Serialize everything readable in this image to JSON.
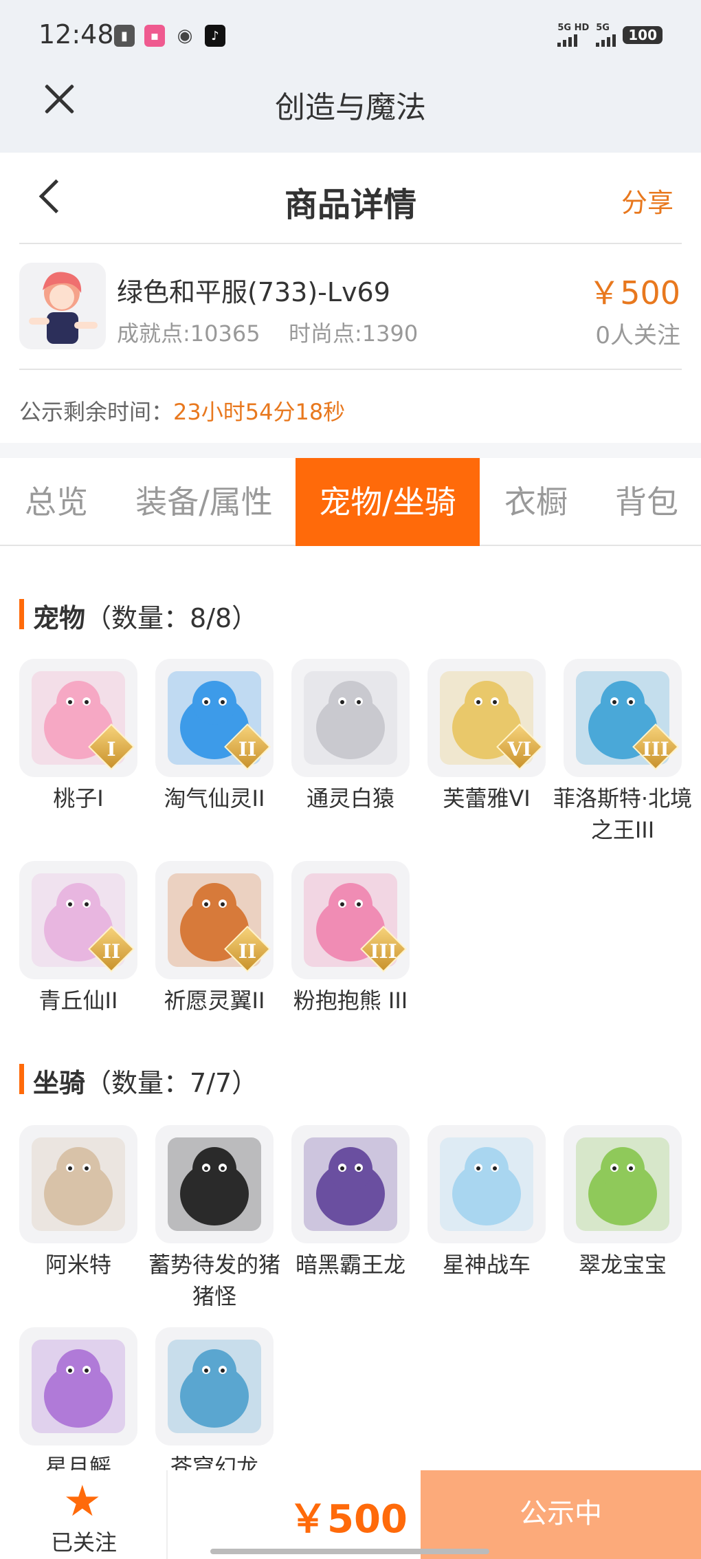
{
  "status_bar": {
    "time": "12:48",
    "network": [
      "5G",
      "HD",
      "5G"
    ],
    "battery": "100"
  },
  "app_bar": {
    "title": "创造与魔法"
  },
  "header": {
    "title": "商品详情",
    "share": "分享"
  },
  "product": {
    "name": "绿色和平服(733)-Lv69",
    "achievement": "成就点:10365",
    "fashion": "时尚点:1390",
    "price": "￥500",
    "followers": "0人关注"
  },
  "notice": {
    "label": "公示剩余时间：",
    "value": "23小时54分18秒"
  },
  "tabs": [
    {
      "label": "总览",
      "active": false
    },
    {
      "label": "装备/属性",
      "active": false
    },
    {
      "label": "宠物/坐骑",
      "active": true
    },
    {
      "label": "衣橱",
      "active": false
    },
    {
      "label": "背包",
      "active": false
    }
  ],
  "pets_section": {
    "title": "宠物",
    "count": "（数量：8/8）",
    "items": [
      {
        "name": "桃子I",
        "badge": "I",
        "color": "#f6a8c4"
      },
      {
        "name": "淘气仙灵II",
        "badge": "II",
        "color": "#3d9be9"
      },
      {
        "name": "通灵白猿",
        "badge": "",
        "color": "#c9c9cf"
      },
      {
        "name": "芙蕾雅VI",
        "badge": "VI",
        "color": "#e9c86a"
      },
      {
        "name": "菲洛斯特·北境之王III",
        "badge": "III",
        "color": "#4aa8d8"
      },
      {
        "name": "青丘仙II",
        "badge": "II",
        "color": "#e8b6e0"
      },
      {
        "name": "祈愿灵翼II",
        "badge": "II",
        "color": "#d77a3a"
      },
      {
        "name": "粉抱抱熊 III",
        "badge": "III",
        "color": "#f08cb4"
      }
    ]
  },
  "mounts_section": {
    "title": "坐骑",
    "count": "（数量：7/7）",
    "items": [
      {
        "name": "阿米特",
        "color": "#d8c2a8"
      },
      {
        "name": "蓄势待发的猪猪怪",
        "color": "#2a2a2a"
      },
      {
        "name": "暗黑霸王龙",
        "color": "#6a4fa0"
      },
      {
        "name": "星神战车",
        "color": "#a9d6f0"
      },
      {
        "name": "翠龙宝宝",
        "color": "#8fc95a"
      },
      {
        "name": "星月鳐",
        "color": "#b07ad8"
      },
      {
        "name": "苍穹幻龙",
        "color": "#5aa6d0"
      }
    ]
  },
  "bottom_bar": {
    "follow_label": "已关注",
    "price": "￥500",
    "button": "公示中"
  }
}
